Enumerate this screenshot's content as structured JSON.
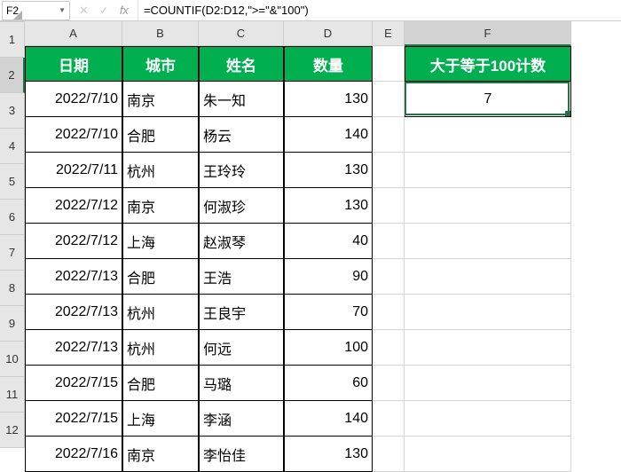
{
  "nameBox": "F2",
  "formula": "=COUNTIF(D2:D12,\">=\"&\"100\")",
  "columns": [
    "A",
    "B",
    "C",
    "D",
    "E",
    "F"
  ],
  "colWidths": [
    "cw-A",
    "cw-B",
    "cw-C",
    "cw-D",
    "cw-E",
    "cw-F"
  ],
  "activeCol": "F",
  "rows": [
    "1",
    "2",
    "3",
    "4",
    "5",
    "6",
    "7",
    "8",
    "9",
    "10",
    "11",
    "12"
  ],
  "activeRow": "2",
  "headers": {
    "A": "日期",
    "B": "城市",
    "C": "姓名",
    "D": "数量",
    "F": "大于等于100计数"
  },
  "resultCell": "7",
  "data": [
    {
      "date": "2022/7/10",
      "city": "南京",
      "name": "朱一知",
      "qty": "130"
    },
    {
      "date": "2022/7/10",
      "city": "合肥",
      "name": "杨云",
      "qty": "140"
    },
    {
      "date": "2022/7/11",
      "city": "杭州",
      "name": "王玲玲",
      "qty": "130"
    },
    {
      "date": "2022/7/12",
      "city": "南京",
      "name": "何淑珍",
      "qty": "130"
    },
    {
      "date": "2022/7/12",
      "city": "上海",
      "name": "赵淑琴",
      "qty": "40"
    },
    {
      "date": "2022/7/13",
      "city": "合肥",
      "name": "王浩",
      "qty": "90"
    },
    {
      "date": "2022/7/13",
      "city": "杭州",
      "name": "王良宇",
      "qty": "70"
    },
    {
      "date": "2022/7/13",
      "city": "杭州",
      "name": "何远",
      "qty": "100"
    },
    {
      "date": "2022/7/15",
      "city": "合肥",
      "name": "马璐",
      "qty": "60"
    },
    {
      "date": "2022/7/15",
      "city": "上海",
      "name": "李涵",
      "qty": "140"
    },
    {
      "date": "2022/7/16",
      "city": "南京",
      "name": "李怡佳",
      "qty": "130"
    }
  ],
  "icons": {
    "cancel": "✕",
    "confirm": "✓",
    "fx": "fx"
  }
}
